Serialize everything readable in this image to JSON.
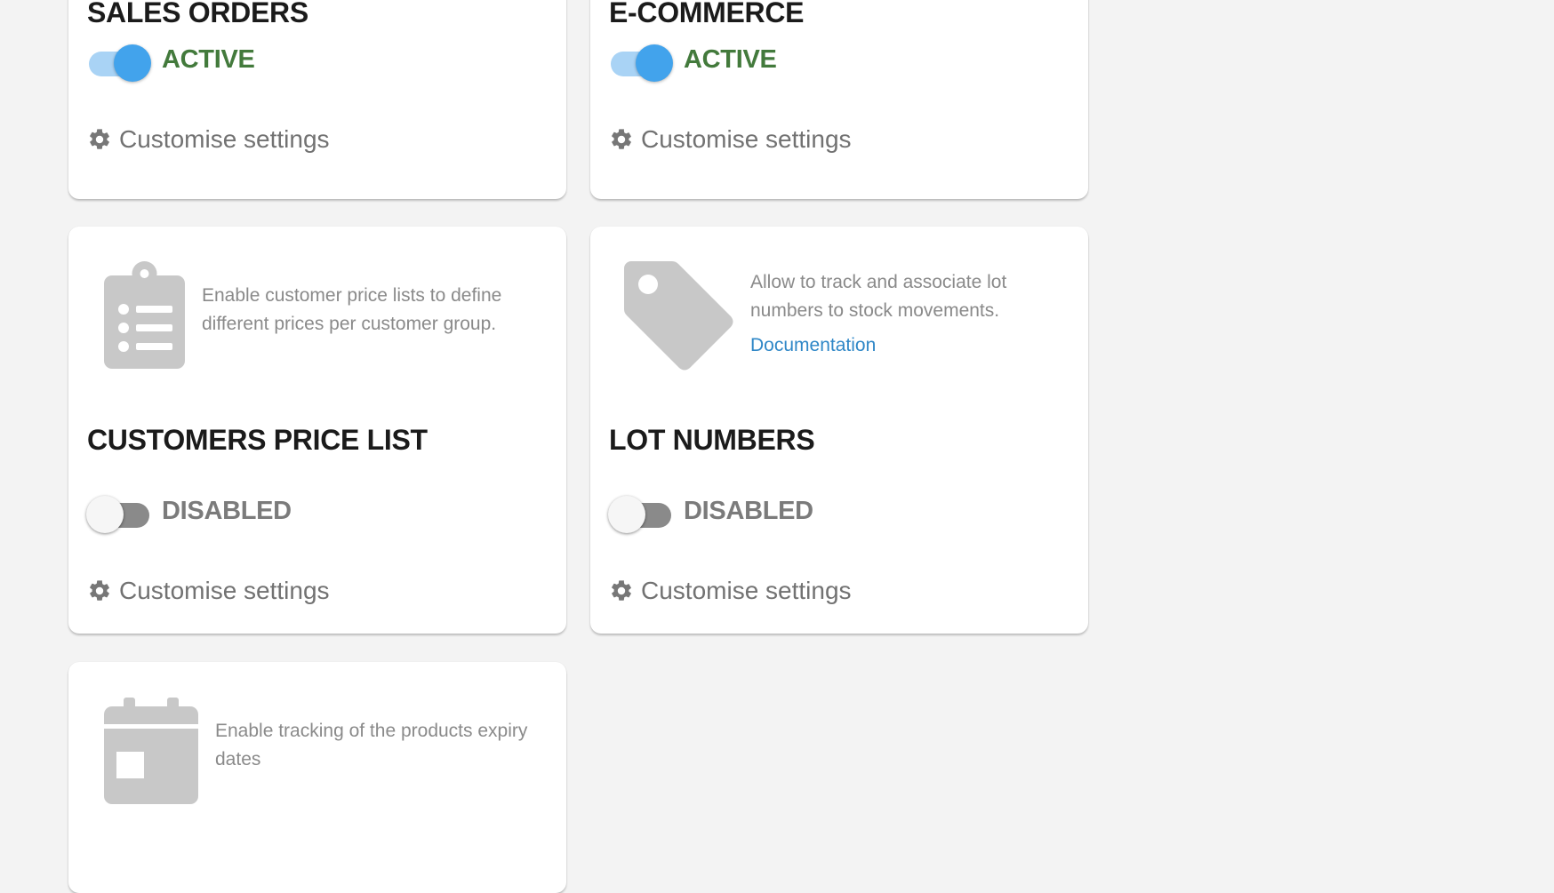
{
  "modules": {
    "sales_orders": {
      "title": "SALES ORDERS",
      "status": "ACTIVE",
      "enabled": true,
      "settings_label": "Customise settings"
    },
    "ecommerce": {
      "title": "E-COMMERCE",
      "status": "ACTIVE",
      "enabled": true,
      "settings_label": "Customise settings"
    },
    "customers_price_list": {
      "icon": "clipboard-list-icon",
      "description": "Enable customer price lists to define different prices per customer group.",
      "title": "CUSTOMERS PRICE LIST",
      "status": "DISABLED",
      "enabled": false,
      "settings_label": "Customise settings"
    },
    "lot_numbers": {
      "icon": "tag-icon",
      "description": "Allow to track and associate lot numbers to stock movements.",
      "doc_link": "Documentation",
      "title": "LOT NUMBERS",
      "status": "DISABLED",
      "enabled": false,
      "settings_label": "Customise settings"
    },
    "expiry_dates": {
      "icon": "calendar-icon",
      "description": "Enable tracking of the products expiry dates"
    }
  },
  "colors": {
    "active_text": "#437a3c",
    "disabled_text": "#7b7b7b",
    "switch_on_thumb": "#42a3ec",
    "switch_on_track": "#a9d3f5",
    "link": "#2f87c7",
    "icon_gray": "#c8c8c8"
  }
}
